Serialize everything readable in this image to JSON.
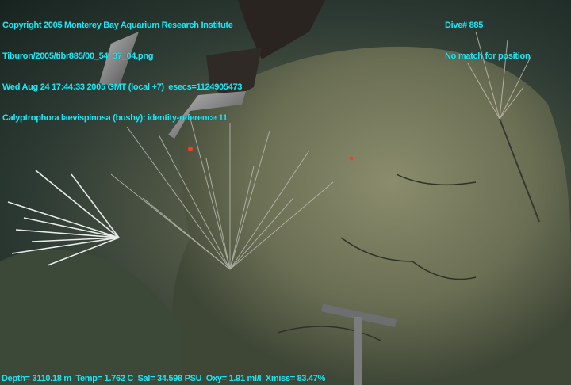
{
  "overlay": {
    "top_left": [
      "Copyright 2005 Monterey Bay Aquarium Research Institute",
      "Tiburon/2005/tibr885/00_54_37_04.png",
      "Wed Aug 24 17:44:33 2005 GMT (local +7)  esecs=1124905473",
      "Calyptrophora laevispinosa (bushy): identity-reference 11"
    ],
    "top_right": [
      "Dive# 885",
      "No match for position"
    ],
    "bottom": "Depth= 3110.18 m  Temp= 1.762 C  Sal= 34.598 PSU  Oxy= 1.91 ml/l  Xmiss= 83.47%"
  },
  "colors": {
    "overlay_text": "#22e4ee",
    "laser_dot": "#ff3a2a"
  }
}
